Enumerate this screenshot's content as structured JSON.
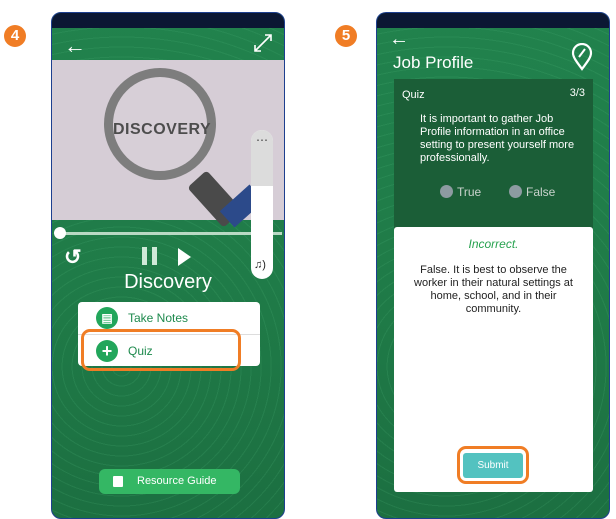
{
  "steps": {
    "left": "4",
    "right": "5"
  },
  "screen1": {
    "image_text": "DISCOVERY",
    "title": "Discovery",
    "menu": [
      "Take Notes",
      "Quiz"
    ],
    "resource_button": "Resource Guide",
    "video_progress": 0.02
  },
  "screen2": {
    "title": "Job Profile",
    "quiz_label": "Quiz",
    "question_counter": "3/3",
    "question": "It is important to gather Job Profile information in an office setting to present yourself more professionally.",
    "options": [
      "True",
      "False"
    ],
    "feedback_title": "Incorrect.",
    "feedback_body": "False. It is best to observe the worker in their natural settings at home, school, and in their community.",
    "submit_label": "Submit"
  },
  "colors": {
    "accent": "#f07d25",
    "green": "#1f7a47",
    "submit": "#53c2c0"
  }
}
